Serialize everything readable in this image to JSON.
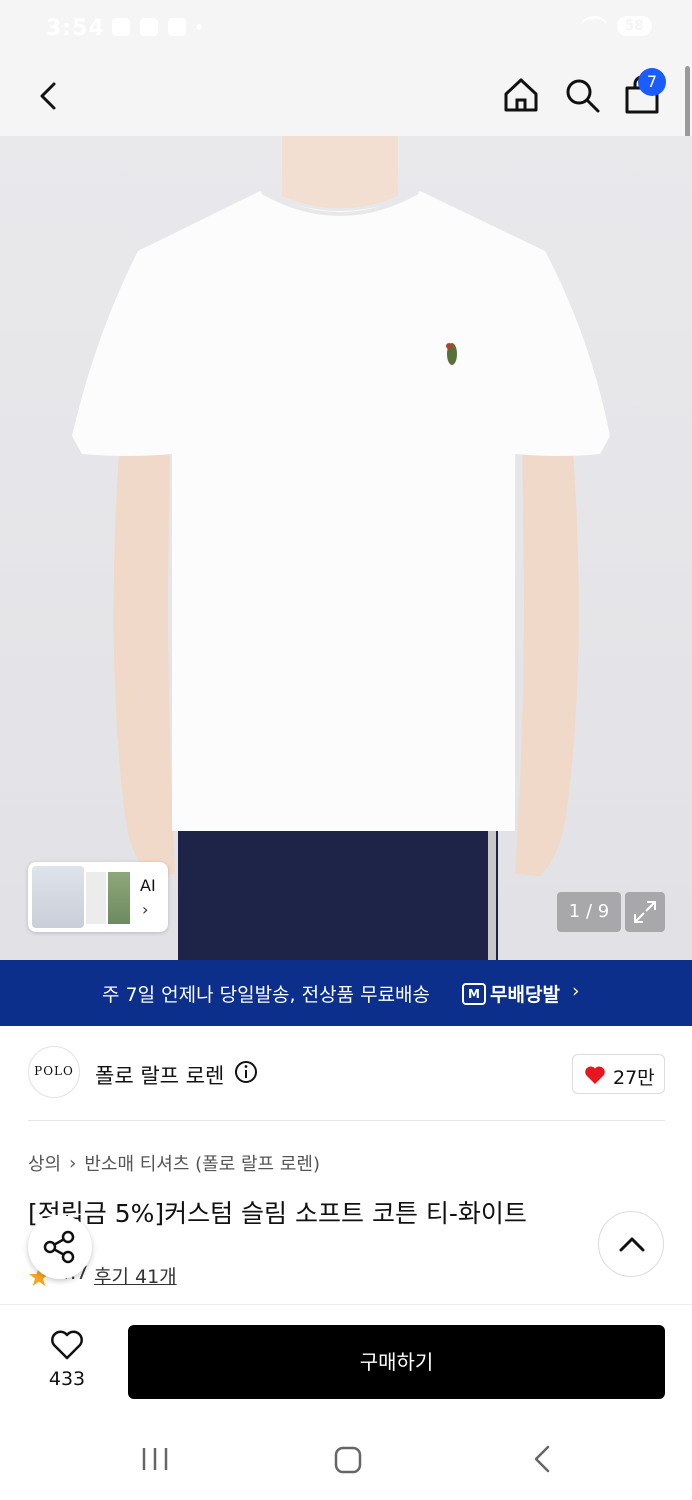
{
  "status_bar": {
    "time": "3:54",
    "battery": "58"
  },
  "header": {
    "cart_count": "7"
  },
  "image_gallery": {
    "thumbnail_label": "AI",
    "page_indicator": "1 / 9"
  },
  "shipping_banner": {
    "text": "주 7일 언제나 당일발송, 전상품 무료배송",
    "brand_label": "무배당발"
  },
  "brand": {
    "logo_text": "POLO",
    "name": "폴로 랄프 로렌",
    "likes": "27만"
  },
  "product": {
    "category_parent": "상의",
    "category_child": "반소매 티셔츠 (폴로 랄프 로렌)",
    "title": "[적립금 5%]커스텀 슬림 소프트 코튼 티-화이트",
    "rating": "4.7",
    "reviews_label": "후기 41개"
  },
  "bottom_bar": {
    "wish_count": "433",
    "buy_label": "구매하기"
  },
  "colors": {
    "banner_bg": "#0b2f8a",
    "badge_bg": "#1a5cff",
    "heart": "#e8171f",
    "star": "#f5a623",
    "buy_bg": "#000000"
  }
}
